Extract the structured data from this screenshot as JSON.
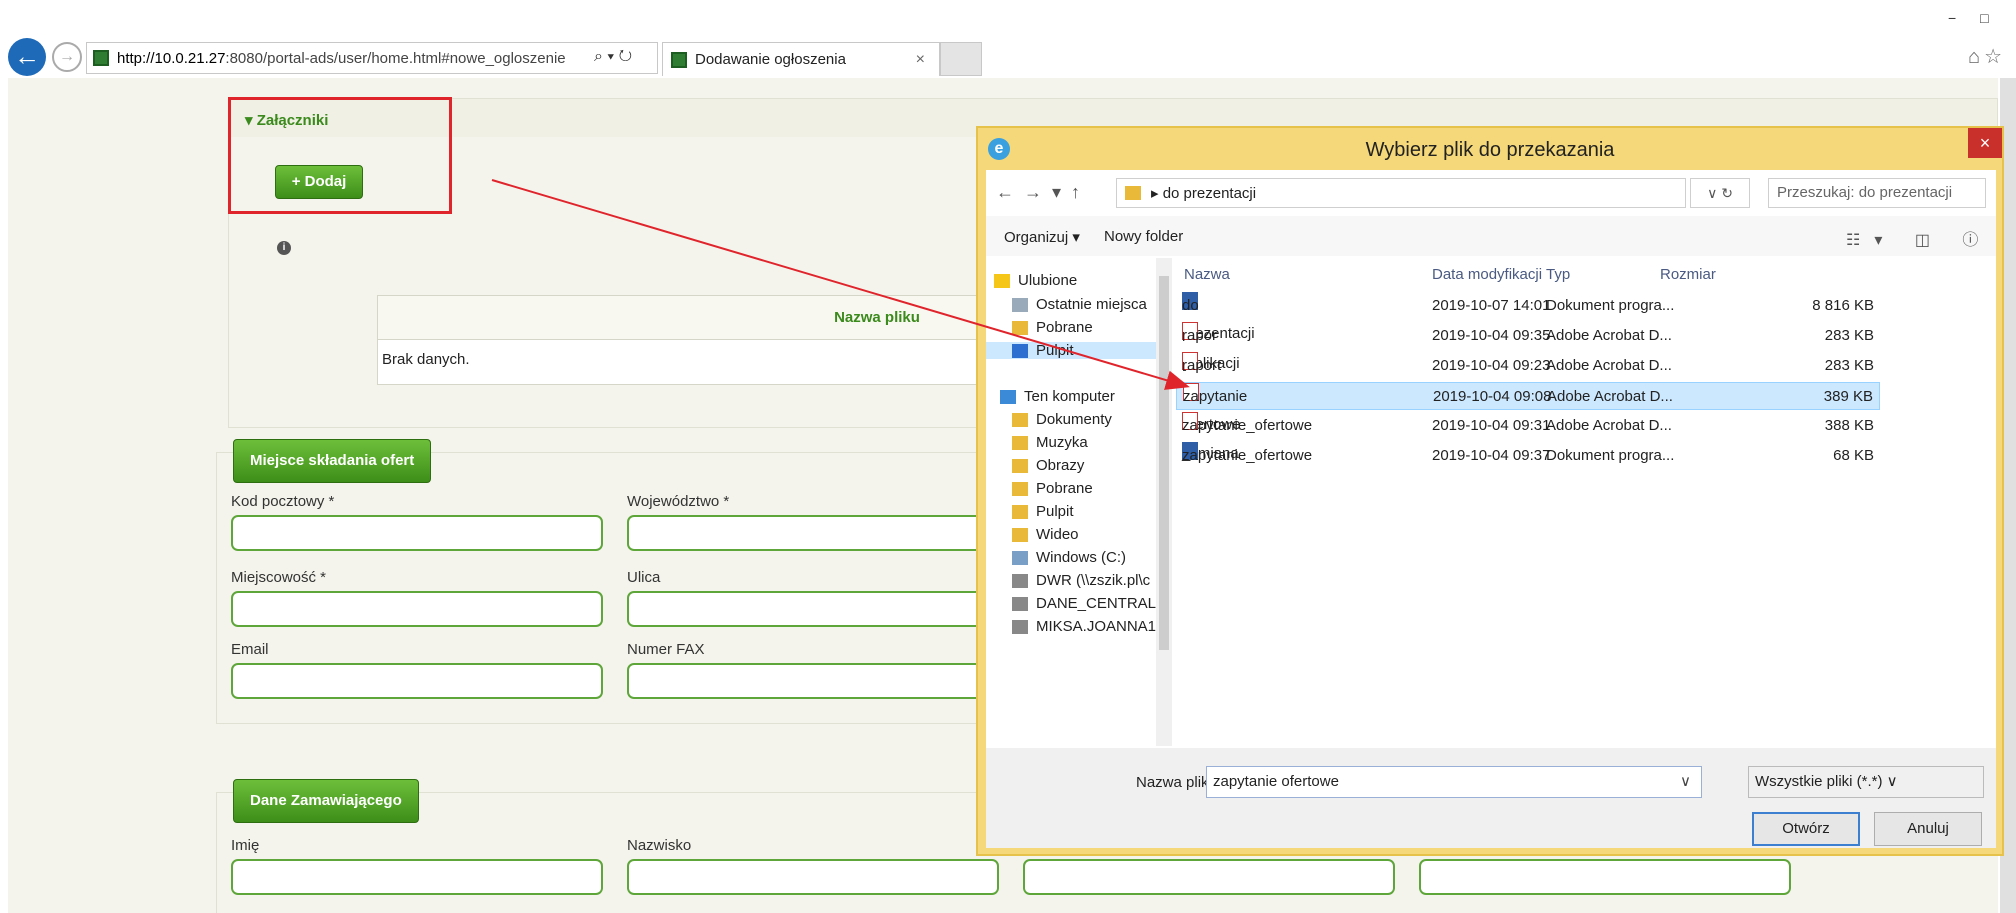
{
  "browser": {
    "url_host": "http://10.0.21.27",
    "url_path": ":8080/portal-ads/user/home.html#nowe_ogloszenie",
    "tab_title": "Dodawanie ogłoszenia",
    "tab_close": "×",
    "url_tools": "⌕ ▾ ↻",
    "window_controls": "− □",
    "right_icons": "⌂☆"
  },
  "attachments": {
    "header": "▾ Załączniki",
    "add_button": "+ Dodaj",
    "table_header": "Nazwa pliku",
    "empty_text": "Brak danych."
  },
  "offer_place": {
    "button": "Miejsce składania ofert",
    "labels": [
      "Kod pocztowy *",
      "Województwo *",
      "Miejscowość *",
      "Ulica",
      "Email",
      "Numer FAX"
    ]
  },
  "buyer": {
    "button": "Dane Zamawiającego",
    "labels": [
      "Imię",
      "Nazwisko"
    ]
  },
  "dialog": {
    "title": "Wybierz plik do przekazania",
    "close": "×",
    "nav_arrows": "←→▾↑",
    "breadcrumb": "▸ do prezentacji",
    "refresh": "∨  ↻",
    "search_placeholder": "Przeszukaj: do prezentacji",
    "organize": "Organizuj ▾",
    "new_folder": "Nowy folder",
    "view_icons": "☷▾ ◫ ⓘ",
    "nav_items": [
      "Ulubione",
      "Ostatnie miejsca",
      "Pobrane",
      "Pulpit",
      "Ten komputer",
      "Dokumenty",
      "Muzyka",
      "Obrazy",
      "Pobrane",
      "Pulpit",
      "Wideo",
      "Windows (C:)",
      "DWR (\\\\zszik.pl\\c",
      "DANE_CENTRAL/",
      "MIKSA.JOANNA1"
    ],
    "columns": {
      "name": "Nazwa",
      "date": "Data modyfikacji",
      "type": "Typ",
      "size": "Rozmiar"
    },
    "files": [
      {
        "name": "do prezentacji",
        "date": "2019-10-07 14:01",
        "type": "Dokument progra...",
        "size": "8 816 KB",
        "icon": "doc"
      },
      {
        "name": "rapor [ublikacji 2",
        "date": "2019-10-04 09:35",
        "type": "Adobe Acrobat D...",
        "size": "283 KB",
        "icon": "pdf"
      },
      {
        "name": "raport publikacji",
        "date": "2019-10-04 09:23",
        "type": "Adobe Acrobat D...",
        "size": "283 KB",
        "icon": "pdf"
      },
      {
        "name": "zapytanie ofertowe",
        "date": "2019-10-04 09:08",
        "type": "Adobe Acrobat D...",
        "size": "389 KB",
        "icon": "pdf"
      },
      {
        "name": "zapytanie_ofertowe _zmiana",
        "date": "2019-10-04 09:31",
        "type": "Adobe Acrobat D...",
        "size": "388 KB",
        "icon": "pdf"
      },
      {
        "name": "zapytanie_ofertowe",
        "date": "2019-10-04 09:37",
        "type": "Dokument progra...",
        "size": "68 KB",
        "icon": "doc"
      }
    ],
    "filename_label": "Nazwa pliku:",
    "filename_value": "zapytanie ofertowe",
    "filename_dropdown": "∨",
    "filetype": "Wszystkie pliki (*.*)   ∨",
    "open_button": "Otwórz",
    "cancel_button": "Anuluj"
  },
  "colors": {
    "accent_green": "#3d8e19",
    "annotation_red": "#e0242c",
    "dialog_frame": "#f4d879"
  }
}
